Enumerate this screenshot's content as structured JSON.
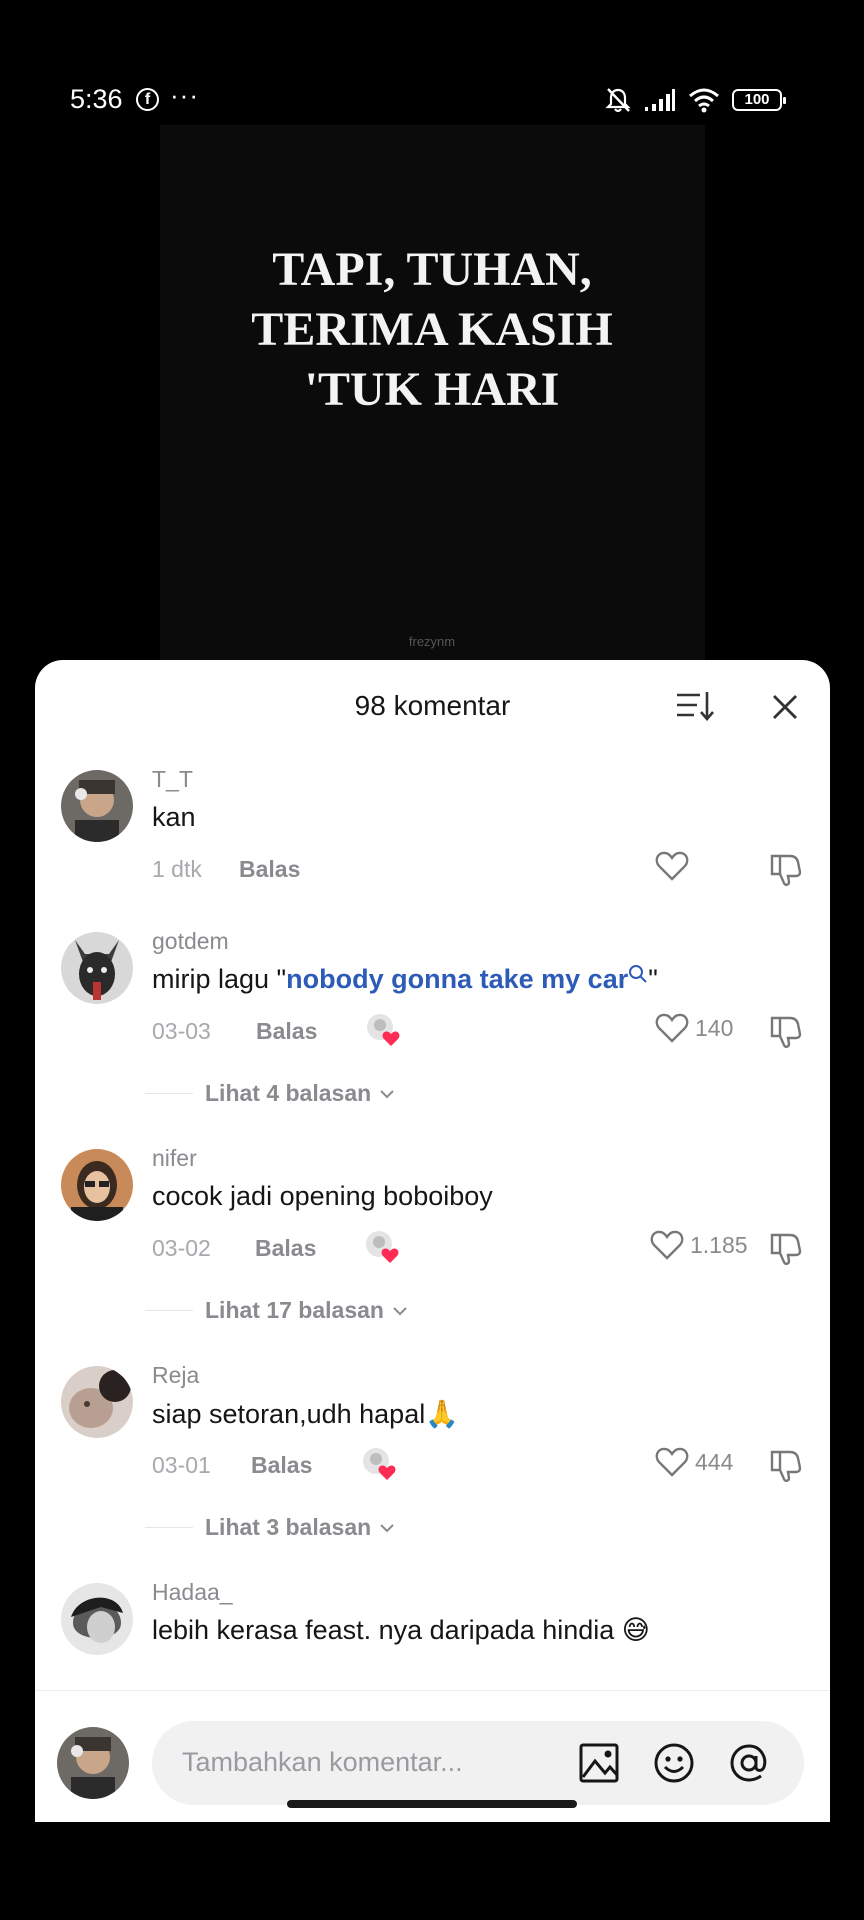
{
  "status_bar": {
    "time": "5:36",
    "fb_icon_letter": "f",
    "dots": "···",
    "battery": "100"
  },
  "video": {
    "lyrics": [
      "TAPI, TUHAN,",
      "TERIMA KASIH",
      "'TUK  HARI"
    ],
    "watermark": "frezynm"
  },
  "sheet": {
    "title": "98 komentar",
    "input_placeholder": "Tambahkan komentar..."
  },
  "comments": [
    {
      "username": "T_T",
      "text": "kan",
      "date": "1 dtk",
      "reply_label": "Balas",
      "likes": ""
    },
    {
      "username": "gotdem",
      "text_before": "mirip lagu \"",
      "link": "nobody gonna take my car",
      "text_after": "\"",
      "date": "03-03",
      "reply_label": "Balas",
      "likes": "140",
      "more_replies": "Lihat 4 balasan"
    },
    {
      "username": "nifer",
      "text": "cocok jadi opening boboiboy",
      "date": "03-02",
      "reply_label": "Balas",
      "likes": "1.185",
      "more_replies": "Lihat 17 balasan"
    },
    {
      "username": "Reja",
      "text": "siap setoran,udh hapal🙏",
      "date": "03-01",
      "reply_label": "Balas",
      "likes": "444",
      "more_replies": "Lihat 3 balasan"
    },
    {
      "username": "Hadaa_",
      "text": "lebih kerasa feast. nya daripada hindia 😅"
    }
  ],
  "colors": {
    "link": "#2d5bb8",
    "creator_heart": "#fe2c55",
    "muted": "#8a8a8f"
  }
}
